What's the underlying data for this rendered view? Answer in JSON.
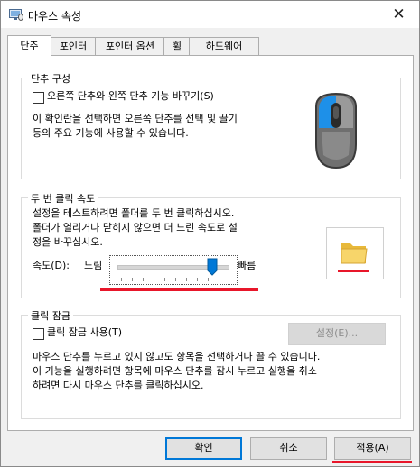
{
  "window": {
    "title": "마우스 속성"
  },
  "tabs": [
    {
      "label": "단추"
    },
    {
      "label": "포인터"
    },
    {
      "label": "포인터 옵션"
    },
    {
      "label": "휠"
    },
    {
      "label": "하드웨어"
    }
  ],
  "button_config": {
    "legend": "단추 구성",
    "swap_checkbox_label": "오른쪽 단추와 왼쪽 단추 기능 바꾸기(S)",
    "swap_checked": false,
    "description_line1": "이 확인란을 선택하면 오른쪽 단추를 선택 및 끌기",
    "description_line2": "등의 주요 기능에 사용할 수 있습니다."
  },
  "double_click": {
    "legend": "두 번 클릭 속도",
    "description_line1": "설정을 테스트하려면 폴더를 두 번 클릭하십시오.",
    "description_line2": "폴더가 열리거나 닫히지 않으면 더 느린 속도로 설",
    "description_line3": "정을 바꾸십시오.",
    "speed_label": "속도(D):",
    "slow_label": "느림",
    "fast_label": "빠름",
    "speed_fraction": 0.86
  },
  "click_lock": {
    "legend": "클릭 잠금",
    "checkbox_label": "클릭 잠금 사용(T)",
    "checked": false,
    "settings_button": "설정(E)...",
    "description_line1": "마우스 단추를 누르고 있지 않고도 항목을 선택하거나 끌 수 있습니다.",
    "description_line2": "이 기능을 실행하려면 항목에 마우스 단추를 잠시 누르고 실행을 취소",
    "description_line3": "하려면 다시 마우스 단추를 클릭하십시오."
  },
  "footer": {
    "ok": "확인",
    "cancel": "취소",
    "apply": "적용(A)"
  },
  "colors": {
    "annotation_red": "#e8162a",
    "mouse_accent": "#1e90e8"
  }
}
